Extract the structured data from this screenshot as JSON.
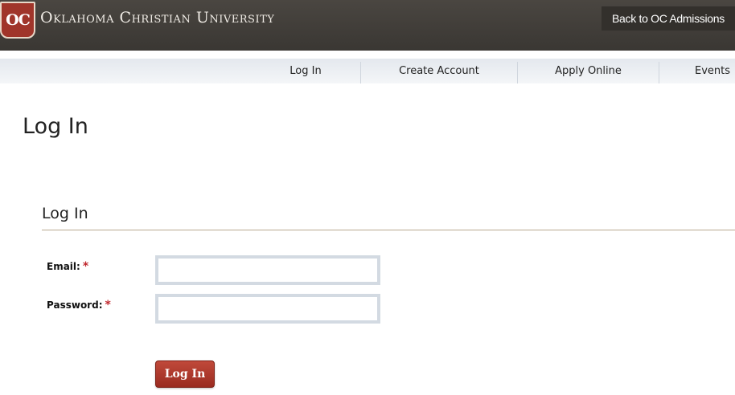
{
  "header": {
    "logo_badge": "OC",
    "logo_text": "Oklahoma Christian University",
    "back_link": "Back to OC Admissions"
  },
  "nav": {
    "items": [
      {
        "label": "Log In"
      },
      {
        "label": "Create Account"
      },
      {
        "label": "Apply Online"
      },
      {
        "label": "Events"
      }
    ]
  },
  "page": {
    "title": "Log In",
    "section_title": "Log In"
  },
  "form": {
    "email_label": "Email:",
    "password_label": "Password:",
    "required_marker": "*",
    "email_value": "",
    "password_value": "",
    "submit_label": "Log In"
  },
  "colors": {
    "header_bg": "#3f3b37",
    "brand_red": "#a0352a",
    "nav_bg": "#eaedf1",
    "required": "#c0272d",
    "input_border": "#d3dae2"
  }
}
